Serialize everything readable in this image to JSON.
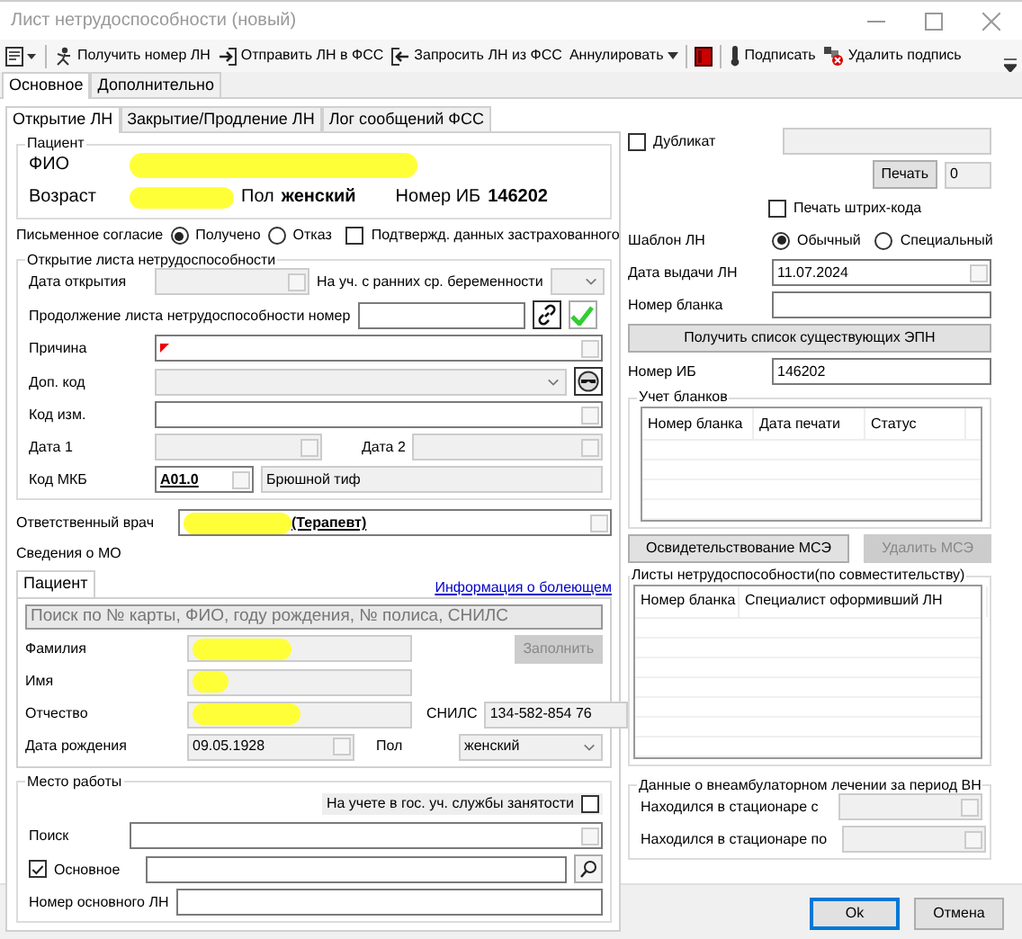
{
  "window": {
    "title": "Лист нетрудоспособности (новый)"
  },
  "toolbar": [
    {
      "kind": "menu"
    },
    {
      "kind": "button",
      "label": "Получить номер ЛН"
    },
    {
      "kind": "button",
      "label": "Отправить ЛН в ФСС"
    },
    {
      "kind": "button",
      "label": "Запросить ЛН из ФСС"
    },
    {
      "kind": "dropdown",
      "label": "Аннулировать"
    },
    {
      "kind": "icon"
    },
    {
      "kind": "button",
      "label": "Подписать"
    },
    {
      "kind": "button",
      "label": "Удалить подпись"
    }
  ],
  "tabs": [
    {
      "label": "Основное",
      "selected": true
    },
    {
      "label": "Дополнительно",
      "selected": false
    }
  ],
  "subtabs": [
    {
      "label": "Открытие ЛН",
      "selected": true
    },
    {
      "label": "Закрытие/Продление ЛН",
      "selected": false
    },
    {
      "label": "Лог сообщений ФСС",
      "selected": false
    }
  ],
  "patient": {
    "title": "Пациент",
    "fio_label": "ФИО",
    "age_label": "Возраст",
    "sex_label": "Пол",
    "sex": "женский",
    "ib_label": "Номер ИБ",
    "ib": "146202"
  },
  "consent": {
    "label": "Письменное согласие",
    "options": [
      {
        "label": "Получено",
        "selected": true
      },
      {
        "label": "Отказ",
        "selected": false
      }
    ],
    "confirm": {
      "label": "Подтвержд. данных застрахованного",
      "checked": false
    }
  },
  "opening": {
    "title": "Открытие листа нетрудоспособности",
    "date_open_label": "Дата открытия",
    "pregnancy_label": "На уч. с ранних ср. беременности",
    "continuation_label": "Продолжение листа нетрудоспособности номер",
    "reason_label": "Причина",
    "extra_code_label": "Доп. код",
    "change_code_label": "Код изм.",
    "date1_label": "Дата 1",
    "date2_label": "Дата 2",
    "mkb_label": "Код МКБ",
    "mkb_code": "A01.0",
    "mkb_name": "Брюшной тиф"
  },
  "doctor": {
    "label": "Ответственный врач",
    "specialty": "(Терапевт)"
  },
  "mo_label": "Сведения о МО",
  "patient_panel": {
    "tabs": [
      {
        "label": "Пациент",
        "selected": true
      }
    ],
    "link": "Информация о болеющем",
    "search_placeholder": "Поиск по № карты, ФИО, году рождения, № полиса, СНИЛС",
    "surname_label": "Фамилия",
    "name_label": "Имя",
    "patronymic_label": "Отчество",
    "birth_label": "Дата рождения",
    "birth": "09.05.1928",
    "snils_label": "СНИЛС",
    "snils": "134-582-854 76",
    "sex_label": "Пол",
    "sex": "женский",
    "fill_button": "Заполнить"
  },
  "work": {
    "title": "Место работы",
    "employment": {
      "label": "На учете в гос. уч. службы занятости",
      "checked": false
    },
    "search_label": "Поиск",
    "main": {
      "label": "Основное",
      "checked": true
    },
    "main_number_label": "Номер основного ЛН"
  },
  "side": {
    "duplicate": {
      "label": "Дубликат",
      "checked": false
    },
    "print_button": "Печать",
    "print_count": "0",
    "barcode": {
      "label": "Печать штрих-кода",
      "checked": false
    },
    "template": {
      "label": "Шаблон ЛН",
      "options": [
        {
          "label": "Обычный",
          "selected": true
        },
        {
          "label": "Специальный",
          "selected": false
        }
      ]
    },
    "issue_date_label": "Дата выдачи ЛН",
    "issue_date": "11.07.2024",
    "blank_label": "Номер бланка",
    "get_list_button": "Получить список существующих ЭПН",
    "ib_label": "Номер ИБ",
    "ib": "146202",
    "blanks": {
      "title": "Учет бланков",
      "columns": [
        "Номер бланка",
        "Дата печати",
        "Статус"
      ]
    },
    "mse_button": {
      "label": "Освидетельствование МСЭ",
      "disabled": false
    },
    "delete_mse_button": {
      "label": "Удалить МСЭ",
      "disabled": true
    },
    "concurrent": {
      "title": "Листы нетрудоспособности(по совместительству)",
      "columns": [
        "Номер бланка",
        "Специалист оформивший ЛН"
      ]
    },
    "inpatient": {
      "title": "Данные о внеамбулаторном лечении за период ВН",
      "from_label": "Находился в стационаре с",
      "to_label": "Находился в стационаре по"
    }
  },
  "buttons": [
    {
      "label": "Ok",
      "default": true
    },
    {
      "label": "Отмена",
      "default": false
    }
  ]
}
